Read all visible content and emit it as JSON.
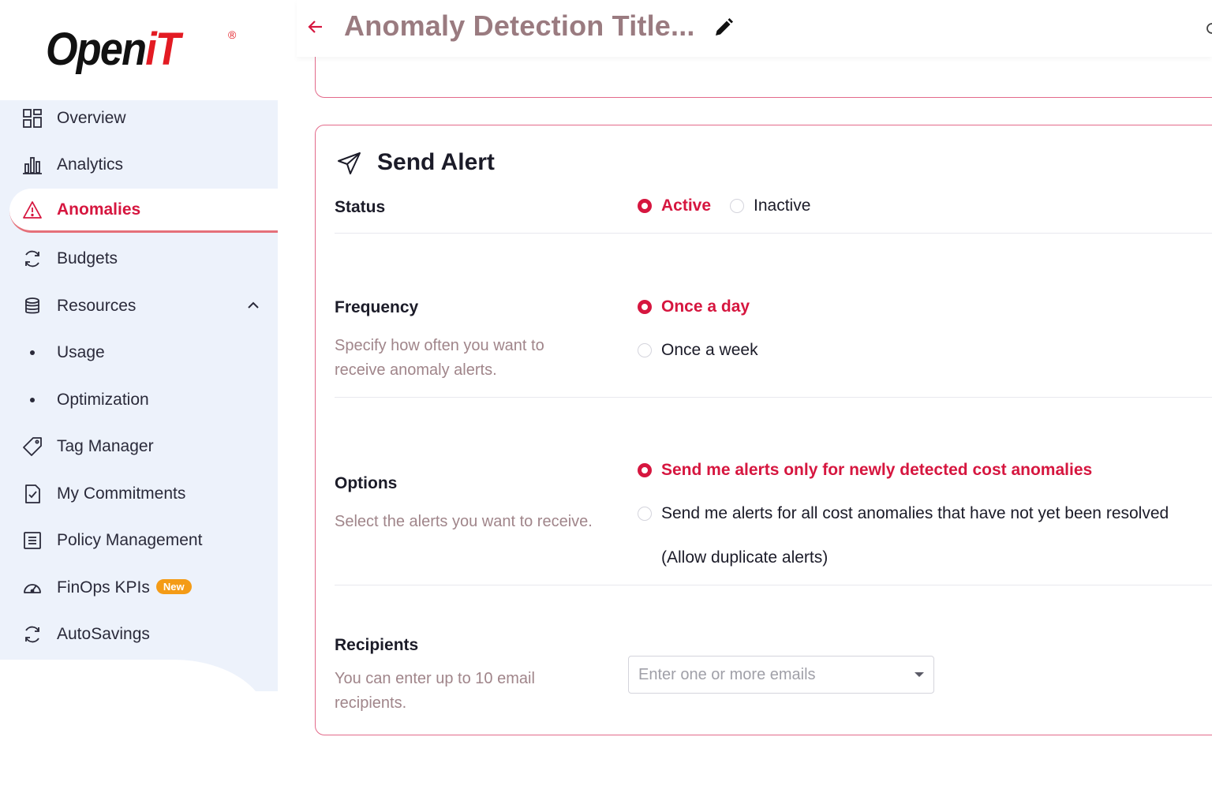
{
  "logo": {
    "brand_open": "Open",
    "brand_it": "iT",
    "registered": "®"
  },
  "sidebar": {
    "items": [
      {
        "label": "Overview",
        "icon": "grid-icon"
      },
      {
        "label": "Analytics",
        "icon": "bar-chart-icon"
      },
      {
        "label": "Anomalies",
        "icon": "warning-icon",
        "active": true
      },
      {
        "label": "Budgets",
        "icon": "refresh-icon"
      },
      {
        "label": "Resources",
        "icon": "database-icon",
        "expanded": true
      },
      {
        "label": "Usage",
        "icon": "bullet"
      },
      {
        "label": "Optimization",
        "icon": "bullet"
      },
      {
        "label": "Tag Manager",
        "icon": "tag-icon"
      },
      {
        "label": "My Commitments",
        "icon": "checked-doc-icon"
      },
      {
        "label": "Policy Management",
        "icon": "list-doc-icon"
      },
      {
        "label": "FinOps KPIs",
        "icon": "gauge-icon",
        "badge": "New"
      },
      {
        "label": "AutoSavings",
        "icon": "refresh-icon"
      }
    ]
  },
  "header": {
    "title": "Anomaly Detection Title..."
  },
  "send_alert": {
    "title": "Send Alert",
    "status": {
      "label": "Status",
      "options": [
        "Active",
        "Inactive"
      ],
      "selected": "Active"
    },
    "frequency": {
      "label": "Frequency",
      "description": "Specify how often you want to receive anomaly alerts.",
      "options": [
        "Once a day",
        "Once a week"
      ],
      "selected": "Once a day"
    },
    "options": {
      "label": "Options",
      "description": "Select the alerts you want to receive.",
      "choices": [
        "Send me alerts only for newly detected cost anomalies",
        "Send me alerts for all cost anomalies that have not yet been resolved"
      ],
      "choice2_note": "(Allow duplicate alerts)",
      "selected": "Send me alerts only for newly detected cost anomalies"
    },
    "recipients": {
      "label": "Recipients",
      "description": "You can enter up to 10 email recipients.",
      "placeholder": "Enter one or more emails",
      "value": ""
    }
  },
  "colors": {
    "accent": "#d6163f",
    "card_border": "#e36a8a",
    "sidebar_bg": "#edf2fb",
    "title": "#9a7b80",
    "badge": "#f49b16"
  }
}
